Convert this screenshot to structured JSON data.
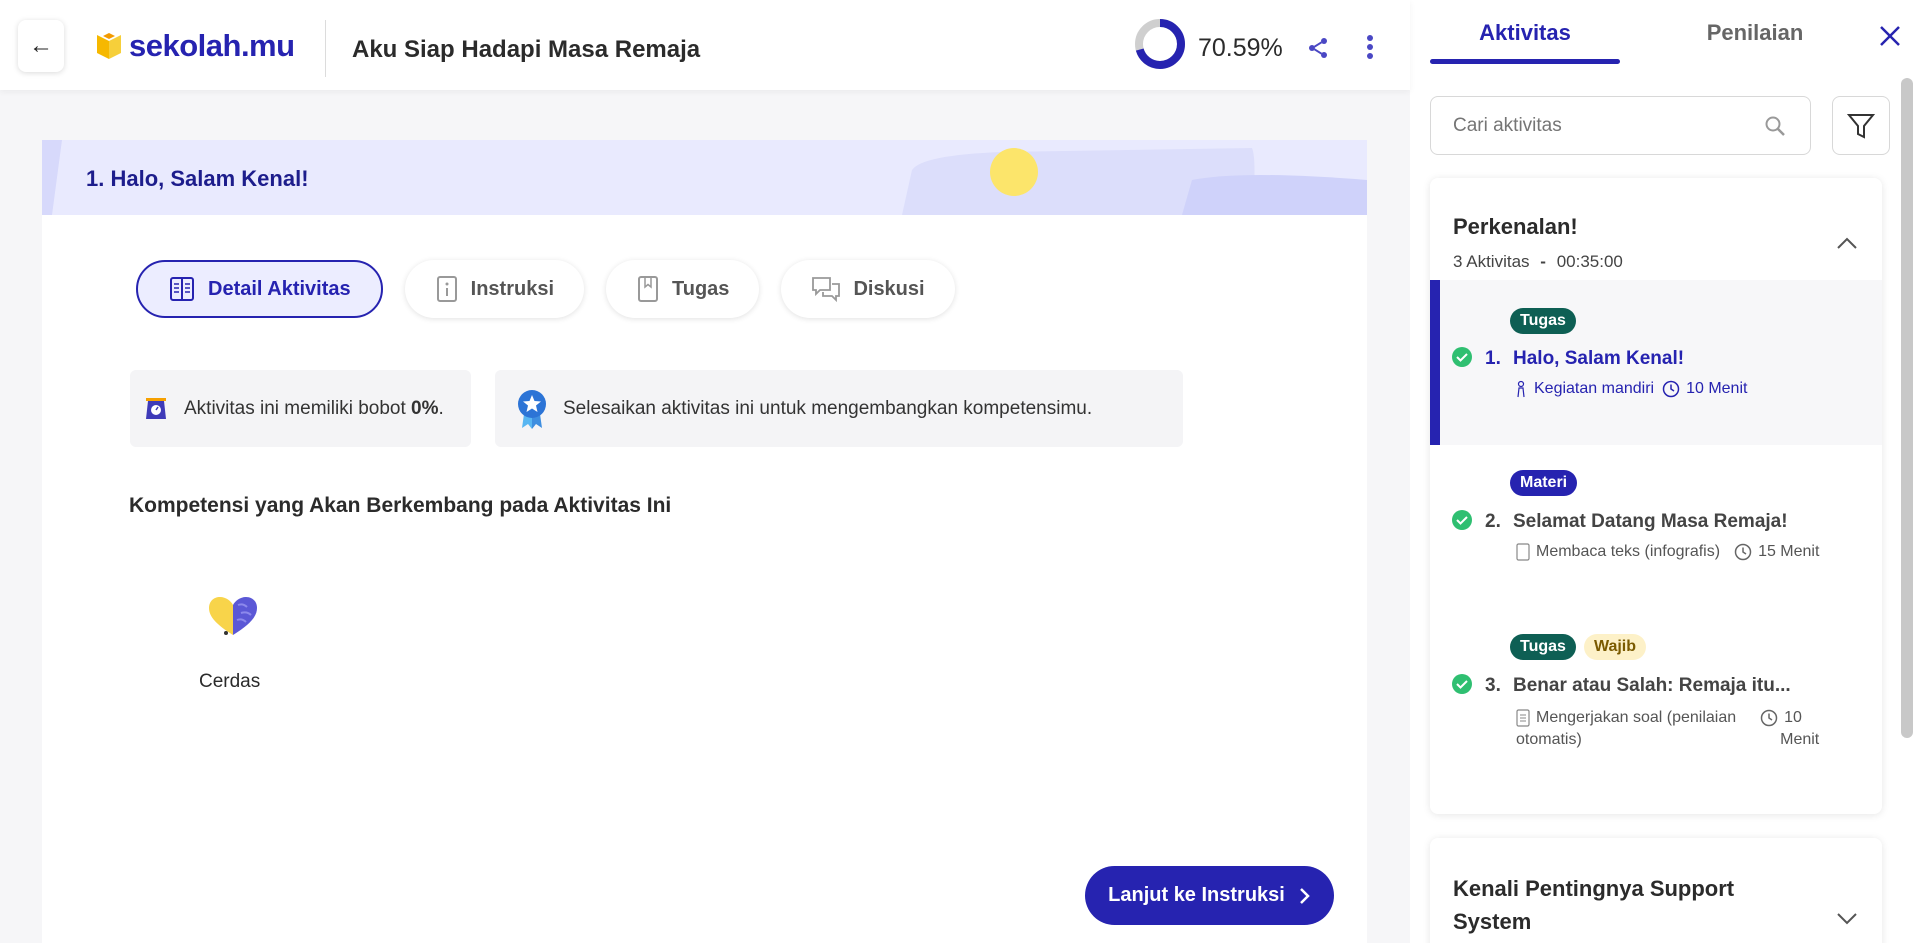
{
  "header": {
    "back_icon": "arrow-left-icon",
    "logo_text": "sekolah.mu",
    "course_title": "Aku Siap Hadapi Masa Remaja",
    "progress_text": "70.59%",
    "progress_value": 70.59
  },
  "main": {
    "banner_title": "1. Halo, Salam Kenal!",
    "tabs": [
      {
        "label": "Detail Aktivitas",
        "icon": "book-open-icon",
        "active": true
      },
      {
        "label": "Instruksi",
        "icon": "info-icon",
        "active": false
      },
      {
        "label": "Tugas",
        "icon": "bookmark-icon",
        "active": false
      },
      {
        "label": "Diskusi",
        "icon": "chat-icon",
        "active": false
      }
    ],
    "weight_prefix": "Aktivitas ini memiliki bobot ",
    "weight_value": "0%",
    "weight_suffix": ".",
    "goal_text": "Selesaikan aktivitas ini untuk mengembangkan kompetensimu.",
    "competency_title": "Kompetensi yang Akan Berkembang pada Aktivitas Ini",
    "competency_label": "Cerdas",
    "next_button": "Lanjut ke Instruksi"
  },
  "sidebar": {
    "tabs": [
      "Aktivitas",
      "Penilaian"
    ],
    "search_placeholder": "Cari aktivitas",
    "group1": {
      "title": "Perkenalan!",
      "count": "3 Aktivitas",
      "separator": "-",
      "duration": "00:35:00",
      "activities": [
        {
          "num": "1.",
          "title": "Halo, Salam Kenal!",
          "badges": [
            "Tugas"
          ],
          "type": "Kegiatan mandiri",
          "time": "10 Menit"
        },
        {
          "num": "2.",
          "title": "Selamat Datang Masa Remaja!",
          "badges": [
            "Materi"
          ],
          "type": "Membaca teks (infografis)",
          "time": "15 Menit"
        },
        {
          "num": "3.",
          "title": "Benar atau Salah: Remaja itu...",
          "badges": [
            "Tugas",
            "Wajib"
          ],
          "type_line1": "Mengerjakan soal (penilaian",
          "type_line2": "otomatis)",
          "time_line1": "10",
          "time_line2": "Menit"
        }
      ]
    },
    "group2": {
      "title": "Kenali Pentingnya Support System"
    }
  },
  "colors": {
    "primary": "#2623b0",
    "banner": "#e9eafe",
    "success": "#2fbf71",
    "tugas_badge": "#0e5f54",
    "wajib_badge": "#fdf1c8"
  }
}
